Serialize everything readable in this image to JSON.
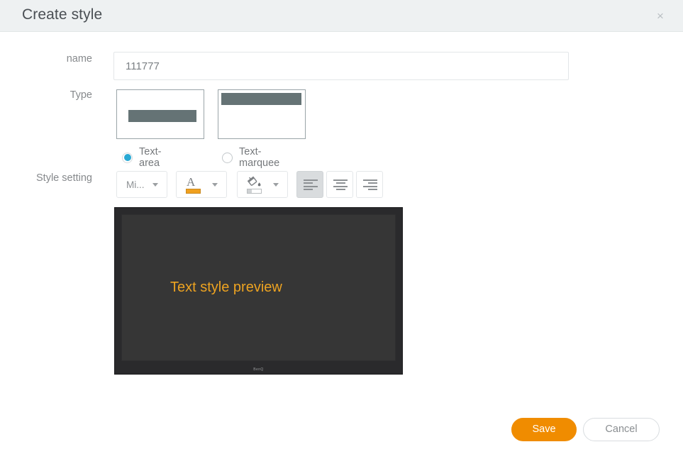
{
  "header": {
    "title": "Create style",
    "close_label": "×"
  },
  "form": {
    "name": {
      "label": "name",
      "value": "111777",
      "placeholder": "111777"
    },
    "type": {
      "label": "Type",
      "options": [
        {
          "id": "text-area",
          "label": "Text-area",
          "selected": true
        },
        {
          "id": "text-marquee",
          "label": "Text-marquee",
          "selected": false
        }
      ]
    },
    "style_setting": {
      "label": "Style setting",
      "font_family_value": "Mi...",
      "font_color_glyph": "A",
      "font_color_swatch": "#f0a01e",
      "fill_color_swatch": "#ffffff",
      "align_options": [
        {
          "id": "align-left",
          "label": "Align left",
          "active": true
        },
        {
          "id": "align-center",
          "label": "Align center",
          "active": false
        },
        {
          "id": "align-right",
          "label": "Align right",
          "active": false
        }
      ]
    }
  },
  "preview": {
    "text": "Text style preview",
    "text_color": "#eda321",
    "screen_color": "#363636",
    "brand_logo": "BenQ"
  },
  "footer": {
    "save_label": "Save",
    "cancel_label": "Cancel",
    "save_color": "#f08c00"
  }
}
